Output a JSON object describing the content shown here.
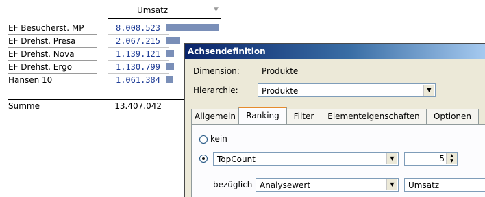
{
  "report": {
    "column_header": "Umsatz",
    "column_filter_icon": "filter-icon",
    "bar_max_value": 8008523,
    "rows": [
      {
        "name": "EF Besucherst. MP",
        "value": "8.008.523",
        "amount": 8008523
      },
      {
        "name": "EF Drehst. Presa",
        "value": "2.067.215",
        "amount": 2067215
      },
      {
        "name": "EF Drehst. Nova",
        "value": "1.139.121",
        "amount": 1139121
      },
      {
        "name": "EF Drehst. Ergo",
        "value": "1.130.799",
        "amount": 1130799
      },
      {
        "name": "Hansen 10",
        "value": "1.061.384",
        "amount": 1061384
      }
    ],
    "total_label": "Summe",
    "total_value": "13.407.042"
  },
  "dialog": {
    "title": "Achsendefinition",
    "dimension_label": "Dimension:",
    "dimension_value": "Produkte",
    "hierarchy_label": "Hierarchie:",
    "hierarchy_value": "Produkte",
    "tabs": [
      {
        "label": "Allgemein",
        "active": false
      },
      {
        "label": "Ranking",
        "active": true
      },
      {
        "label": "Filter",
        "active": false
      },
      {
        "label": "Elementeigenschaften",
        "active": false
      },
      {
        "label": "Optionen",
        "active": false
      }
    ],
    "ranking": {
      "option_none_label": "kein",
      "option_none_selected": false,
      "option_topcount_selected": true,
      "topcount_value": "TopCount",
      "count_value": "5",
      "relative_label": "bezüglich",
      "relative_value": "Analysewert",
      "measure_value": "Umsatz"
    }
  },
  "colors": {
    "value_text": "#1e3c96",
    "bar": "#7a8fb8",
    "title_bar_start": "#0a246a",
    "dialog_bg": "#ece9d8"
  }
}
